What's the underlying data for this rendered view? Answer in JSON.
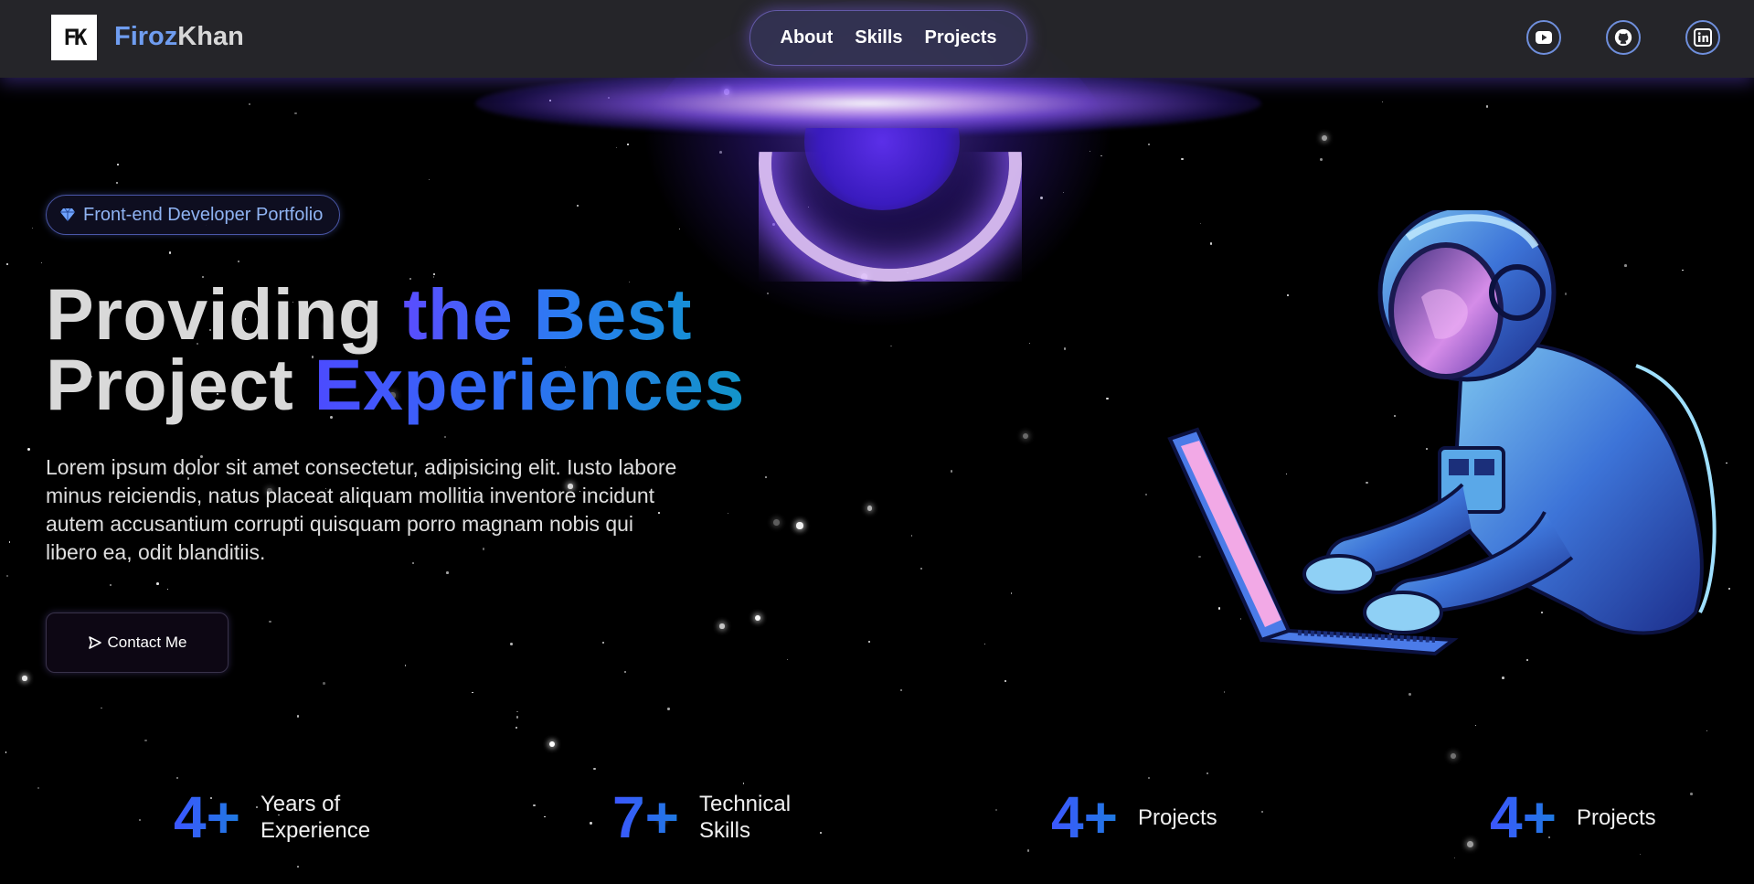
{
  "brand": {
    "logo_text": "FK",
    "first": "Firoz",
    "last": "Khan"
  },
  "nav": {
    "items": [
      "About",
      "Skills",
      "Projects"
    ]
  },
  "social": [
    {
      "icon": "youtube-icon"
    },
    {
      "icon": "github-icon"
    },
    {
      "icon": "linkedin-icon"
    }
  ],
  "hero": {
    "badge_icon": "diamond-icon",
    "badge": "Front-end Developer Portfolio",
    "headline": {
      "line1_plain": "Providing ",
      "line1_accent": "the Best",
      "line2_plain": "Project ",
      "line2_accent": "Experiences"
    },
    "description": "Lorem ipsum dolor sit amet consectetur, adipisicing elit. Iusto labore minus reiciendis, natus placeat aliquam mollitia inventore incidunt autem accusantium corrupti quisquam porro magnam nobis qui libero ea, odit blanditiis.",
    "contact_icon": "send-icon",
    "contact_label": "Contact Me"
  },
  "stats": [
    {
      "number": "4+",
      "label_line1": "Years of",
      "label_line2": "Experience"
    },
    {
      "number": "7+",
      "label_line1": "Technical",
      "label_line2": "Skills"
    },
    {
      "number": "4+",
      "label_line1": "Projects",
      "label_line2": ""
    },
    {
      "number": "4+",
      "label_line1": "Projects",
      "label_line2": ""
    }
  ],
  "colors": {
    "accent_blue": "#6f9df0",
    "gradient_start": "#5a4cff",
    "gradient_end": "#168fd6",
    "glow_purple": "#8c5aff"
  }
}
